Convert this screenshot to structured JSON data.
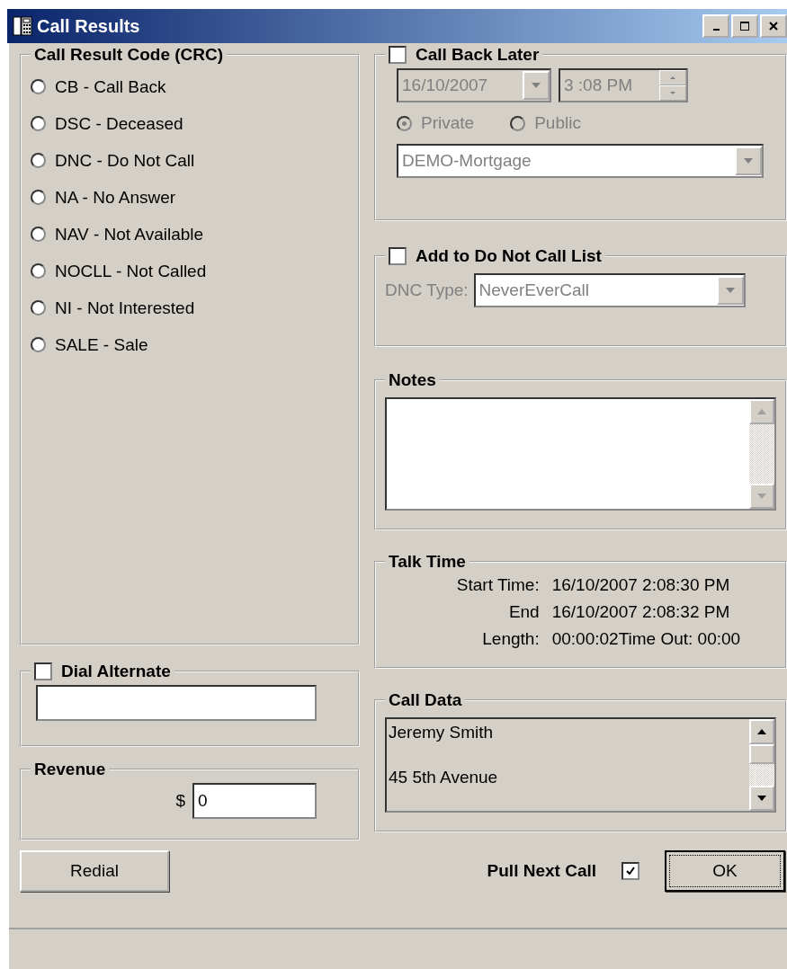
{
  "window": {
    "title": "Call Results"
  },
  "crc": {
    "title": "Call Result Code (CRC)",
    "options": [
      {
        "label": "CB - Call Back",
        "selected": false
      },
      {
        "label": "DSC - Deceased",
        "selected": false
      },
      {
        "label": "DNC - Do Not Call",
        "selected": false
      },
      {
        "label": "NA - No Answer",
        "selected": false
      },
      {
        "label": "NAV - Not Available",
        "selected": false
      },
      {
        "label": "NOCLL - Not Called",
        "selected": false
      },
      {
        "label": "NI - Not Interested",
        "selected": false
      },
      {
        "label": "SALE - Sale",
        "selected": false
      }
    ]
  },
  "dial_alternate": {
    "label": "Dial Alternate",
    "checked": false
  },
  "revenue": {
    "title": "Revenue",
    "currency": "$",
    "value": "0"
  },
  "call_back_later": {
    "label": "Call Back Later",
    "checked": false,
    "disabled": true,
    "date": "16/10/2007",
    "time": "3 :08 PM",
    "visibility": [
      {
        "label": "Private",
        "selected": true
      },
      {
        "label": "Public",
        "selected": false
      }
    ],
    "campaign": "DEMO-Mortgage"
  },
  "do_not_call": {
    "label": "Add to Do Not Call List",
    "checked": false,
    "disabled": true,
    "type_label": "DNC Type:",
    "type_value": "NeverEverCall"
  },
  "notes": {
    "title": "Notes"
  },
  "talk_time": {
    "title": "Talk Time",
    "rows": [
      {
        "label": "Start Time:",
        "value": "16/10/2007 2:08:30 PM"
      },
      {
        "label": "End",
        "value": "16/10/2007 2:08:32 PM"
      },
      {
        "label": "Length:",
        "value": "00:00:02Time Out: 00:00"
      }
    ]
  },
  "call_data": {
    "title": "Call Data",
    "lines": [
      "Jeremy Smith",
      "45 5th Avenue"
    ]
  },
  "footer": {
    "redial": "Redial",
    "pull_next_call": {
      "label": "Pull Next Call",
      "checked": true
    },
    "ok": "OK"
  }
}
